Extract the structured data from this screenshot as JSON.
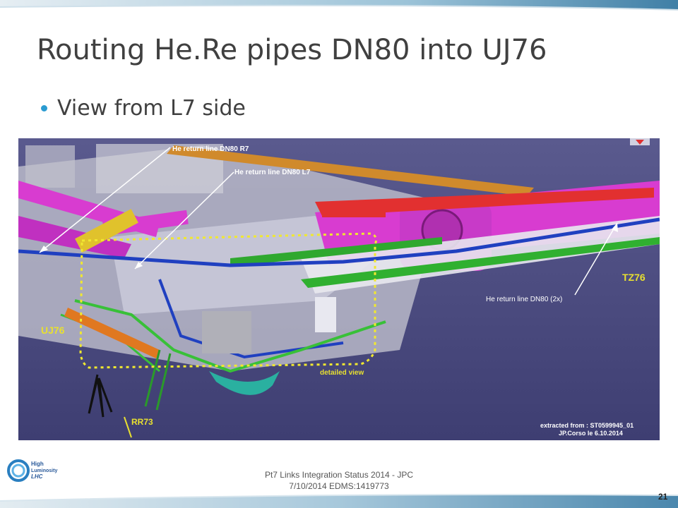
{
  "slide": {
    "title": "Routing He.Re pipes DN80 into UJ76",
    "bullet": "View from L7 side",
    "footer_line1": "Pt7 Links Integration Status 2014 - JPC",
    "footer_line2": "7/10/2014  EDMS:1419773",
    "page_number": "21"
  },
  "logo": {
    "line1": "High",
    "line2": "Luminosity",
    "line3": "LHC"
  },
  "figure": {
    "label_r7": "He return line DN80 R7",
    "label_l7": "He return line DN80 L7",
    "label_2x": "He return line DN80 (2x)",
    "label_tz76": "TZ76",
    "label_uj76": "UJ76",
    "label_rr73": "RR73",
    "label_detailed": "detailed view",
    "extract_line1": "extracted from : ST0599945_01",
    "extract_line2": "JP.Corso le 6.10.2014"
  },
  "colors": {
    "accent": "#2a9bd1",
    "title": "#404040",
    "figure_background": "#4a4a80",
    "pipe_magenta": "#d83cd0",
    "label_yellow": "#e8e030"
  }
}
